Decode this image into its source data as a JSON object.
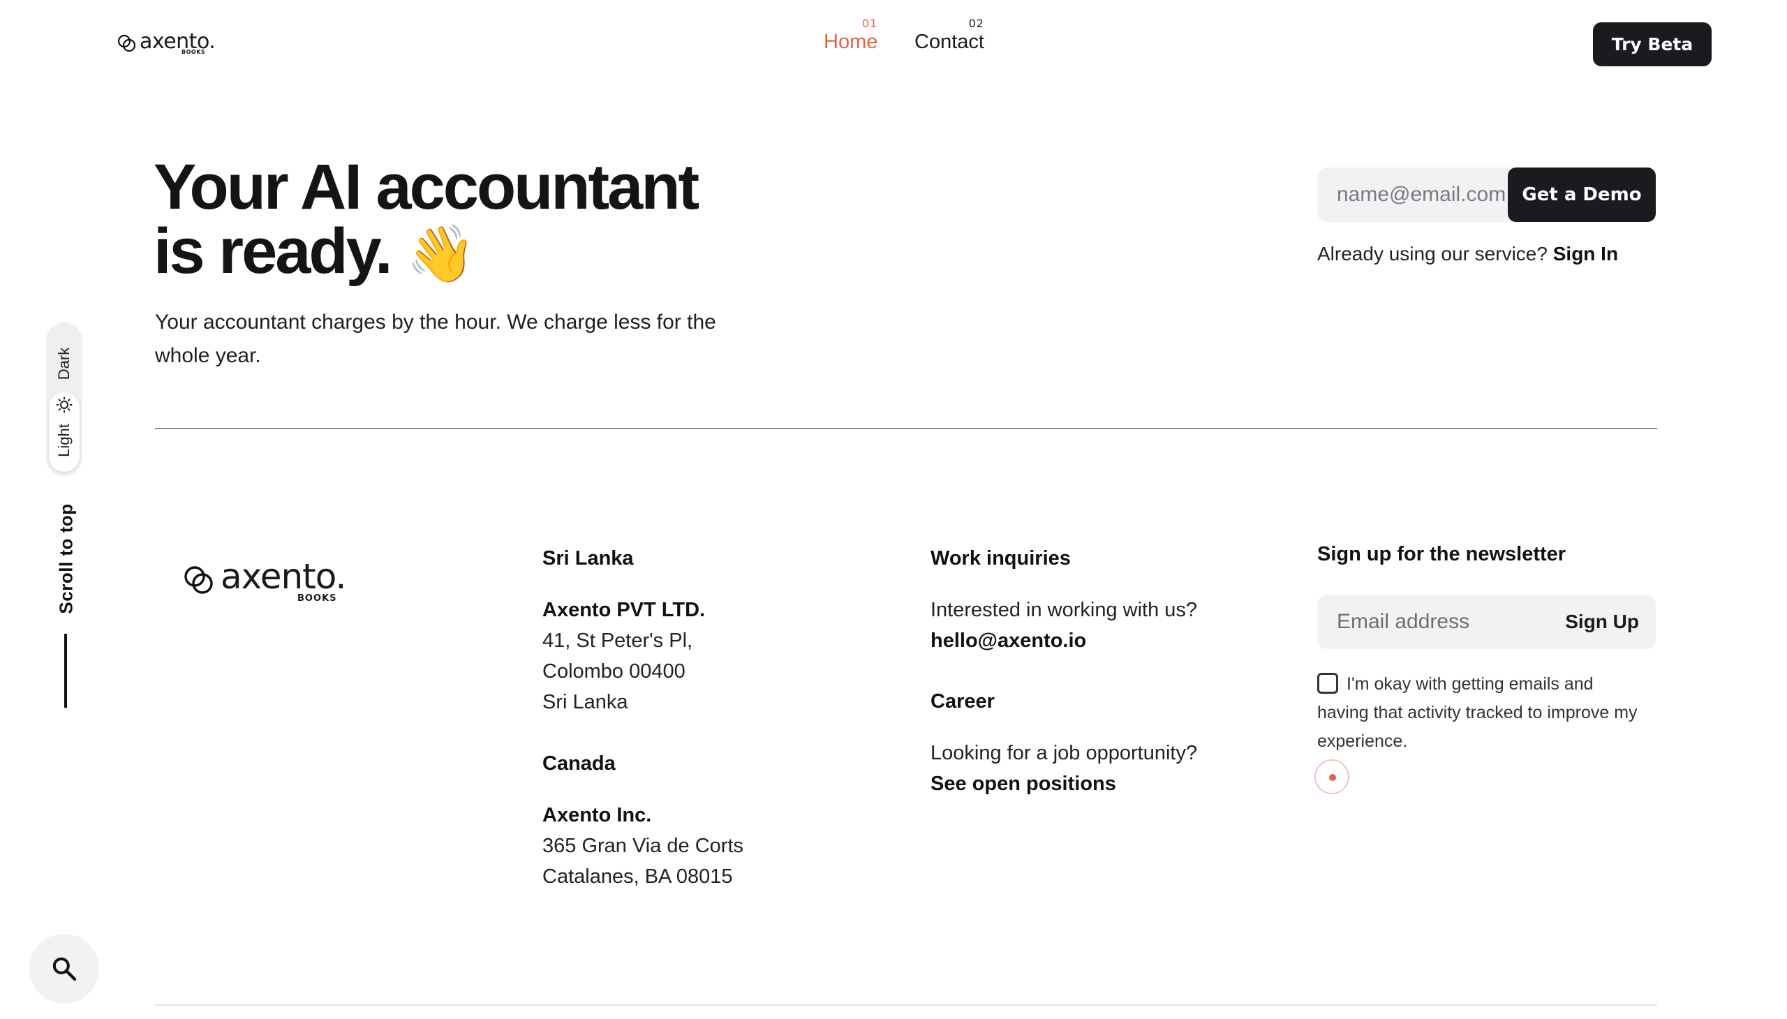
{
  "header": {
    "logo_word": "axento.",
    "logo_sub": "BOOKS",
    "nav": [
      {
        "num": "01",
        "label": "Home"
      },
      {
        "num": "02",
        "label": "Contact"
      }
    ],
    "cta_label": "Try Beta",
    "accent_color": "#e2624a"
  },
  "hero": {
    "title_line1": "Your AI accountant",
    "title_line2": "is ready.",
    "title_emoji": "👋",
    "subtitle": "Your accountant charges by the hour. We charge less for the whole year.",
    "email_placeholder": "name@email.com",
    "demo_button": "Get a Demo",
    "signin_prompt": "Already using our service?",
    "signin_link": "Sign In"
  },
  "side": {
    "theme_dark": "Dark",
    "theme_light": "Light",
    "scroll_to_top": "Scroll to top",
    "search_icon": "search-icon"
  },
  "footer": {
    "logo_word": "axento.",
    "logo_sub": "BOOKS",
    "offices": [
      {
        "region": "Sri Lanka",
        "company": "Axento PVT LTD.",
        "line1": "41, St Peter's Pl,",
        "line2": "Colombo 00400",
        "line3": "Sri Lanka"
      },
      {
        "region": "Canada",
        "company": "Axento Inc.",
        "line1": "365 Gran Via de Corts",
        "line2": "Catalanes, BA 08015"
      }
    ],
    "work": {
      "heading": "Work inquiries",
      "text": "Interested in working with us?",
      "email": "hello@axento.io"
    },
    "career": {
      "heading": "Career",
      "text": "Looking for a job opportunity?",
      "link": "See open positions"
    },
    "newsletter": {
      "heading": "Sign up for the newsletter",
      "placeholder": "Email address",
      "button": "Sign Up",
      "consent": "I'm okay with getting emails and having that activity tracked to improve my experience."
    }
  }
}
